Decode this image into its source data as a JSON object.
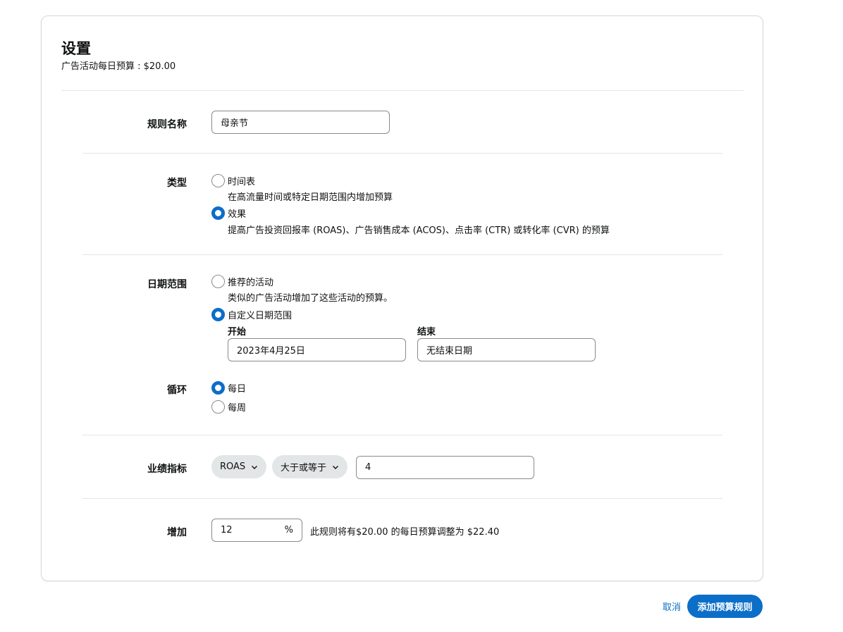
{
  "settings": {
    "title": "设置",
    "subtitle": "广告活动每日预算 : $20.00"
  },
  "rule_name": {
    "label": "规则名称",
    "value": "母亲节"
  },
  "type": {
    "label": "类型",
    "options": [
      {
        "label": "时间表",
        "desc": "在高流量时间或特定日期范围内增加预算",
        "checked": false
      },
      {
        "label": "效果",
        "desc": "提高广告投资回报率 (ROAS)、广告销售成本 (ACOS)、点击率 (CTR) 或转化率 (CVR) 的预算",
        "checked": true
      }
    ]
  },
  "date_range": {
    "label": "日期范围",
    "options": [
      {
        "label": "推荐的活动",
        "desc": "类似的广告活动增加了这些活动的预算。",
        "checked": false
      },
      {
        "label": "自定义日期范围",
        "checked": true
      }
    ],
    "start_label": "开始",
    "start_value": "2023年4月25日",
    "end_label": "结束",
    "end_value": "无结束日期"
  },
  "recurrence": {
    "label": "循环",
    "options": [
      {
        "label": "每日",
        "checked": true
      },
      {
        "label": "每周",
        "checked": false
      }
    ]
  },
  "metric": {
    "label": "业绩指标",
    "metric_select": "ROAS",
    "operator_select": "大于或等于",
    "value": "4"
  },
  "increase": {
    "label": "增加",
    "value": "12",
    "suffix": "%",
    "note": "此规则将有$20.00 的每日预算调整为 $22.40"
  },
  "footer": {
    "cancel_label": "取消",
    "submit_label": "添加预算规则"
  },
  "colors": {
    "accent": "#0b6ec8",
    "border": "#888c8c",
    "divider": "#e3e6e6",
    "pill_bg": "#e3e6e6"
  },
  "icons": {
    "dropdown": "chevron-down-icon"
  }
}
